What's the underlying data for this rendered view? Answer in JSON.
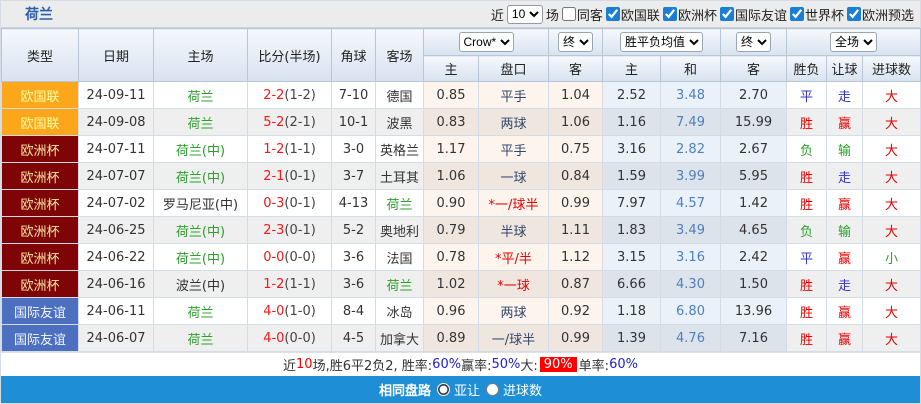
{
  "title": "荷兰",
  "controls": {
    "recent_label": "近",
    "matches_count": "10",
    "matches_label": "场",
    "checkboxes": [
      {
        "label": "同客",
        "checked": false
      },
      {
        "label": "欧国联",
        "checked": true
      },
      {
        "label": "欧洲杯",
        "checked": true
      },
      {
        "label": "国际友谊",
        "checked": true
      },
      {
        "label": "世界杯",
        "checked": true
      },
      {
        "label": "欧洲预选",
        "checked": true
      }
    ]
  },
  "header": {
    "columns": [
      "类型",
      "日期",
      "主场",
      "比分(半场)",
      "角球",
      "客场"
    ],
    "selects": {
      "odds_source": "Crow*",
      "odds_time1": "终",
      "avg_source": "胜平负均值",
      "odds_time2": "终",
      "scope": "全场"
    },
    "sub_columns": [
      "主",
      "盘口",
      "客",
      "主",
      "和",
      "客",
      "胜负",
      "让球",
      "进球数"
    ]
  },
  "rows": [
    {
      "type": "欧国联",
      "type_class": "t-nations",
      "date": "24-09-11",
      "home": "荷兰",
      "home_class": "green",
      "score": "2-2",
      "half": "(1-2)",
      "corners": "7-10",
      "away": "德国",
      "away_class": "",
      "crow_home": "0.85",
      "handicap": "平手",
      "handicap_class": "",
      "crow_away": "1.04",
      "avg_home": "2.52",
      "avg_draw": "3.48",
      "avg_away": "2.70",
      "result": "平",
      "result_class": "c-blue",
      "hres": "走",
      "hres_class": "c-blue",
      "goals": "大",
      "goals_class": "c-red"
    },
    {
      "type": "欧国联",
      "type_class": "t-nations",
      "date": "24-09-08",
      "home": "荷兰",
      "home_class": "green",
      "score": "5-2",
      "half": "(2-1)",
      "corners": "10-1",
      "away": "波黑",
      "away_class": "",
      "crow_home": "0.83",
      "handicap": "两球",
      "handicap_class": "",
      "crow_away": "1.06",
      "avg_home": "1.16",
      "avg_draw": "7.49",
      "avg_away": "15.99",
      "result": "胜",
      "result_class": "c-red",
      "hres": "赢",
      "hres_class": "c-red",
      "goals": "大",
      "goals_class": "c-red"
    },
    {
      "type": "欧洲杯",
      "type_class": "t-euro",
      "date": "24-07-11",
      "home": "荷兰(中)",
      "home_class": "green",
      "score": "1-2",
      "half": "(1-1)",
      "corners": "3-0",
      "away": "英格兰",
      "away_class": "",
      "crow_home": "1.17",
      "handicap": "平手",
      "handicap_class": "",
      "crow_away": "0.75",
      "avg_home": "3.16",
      "avg_draw": "2.82",
      "avg_away": "2.67",
      "result": "负",
      "result_class": "c-green",
      "hres": "输",
      "hres_class": "c-green",
      "goals": "大",
      "goals_class": "c-red"
    },
    {
      "type": "欧洲杯",
      "type_class": "t-euro",
      "date": "24-07-07",
      "home": "荷兰(中)",
      "home_class": "green",
      "score": "2-1",
      "half": "(0-1)",
      "corners": "3-7",
      "away": "土耳其",
      "away_class": "",
      "crow_home": "1.06",
      "handicap": "一球",
      "handicap_class": "",
      "crow_away": "0.84",
      "avg_home": "1.59",
      "avg_draw": "3.99",
      "avg_away": "5.95",
      "result": "胜",
      "result_class": "c-red",
      "hres": "走",
      "hres_class": "c-blue",
      "goals": "大",
      "goals_class": "c-red"
    },
    {
      "type": "欧洲杯",
      "type_class": "t-euro",
      "date": "24-07-02",
      "home": "罗马尼亚(中)",
      "home_class": "",
      "score": "0-3",
      "half": "(0-1)",
      "corners": "4-13",
      "away": "荷兰",
      "away_class": "green",
      "crow_home": "0.90",
      "handicap": "*一/球半",
      "handicap_class": "hcp-red",
      "crow_away": "0.99",
      "avg_home": "7.97",
      "avg_draw": "4.57",
      "avg_away": "1.42",
      "result": "胜",
      "result_class": "c-red",
      "hres": "赢",
      "hres_class": "c-red",
      "goals": "大",
      "goals_class": "c-red"
    },
    {
      "type": "欧洲杯",
      "type_class": "t-euro",
      "date": "24-06-25",
      "home": "荷兰(中)",
      "home_class": "green",
      "score": "2-3",
      "half": "(0-1)",
      "corners": "5-2",
      "away": "奥地利",
      "away_class": "",
      "crow_home": "0.79",
      "handicap": "半球",
      "handicap_class": "",
      "crow_away": "1.11",
      "avg_home": "1.83",
      "avg_draw": "3.49",
      "avg_away": "4.65",
      "result": "负",
      "result_class": "c-green",
      "hres": "输",
      "hres_class": "c-green",
      "goals": "大",
      "goals_class": "c-red"
    },
    {
      "type": "欧洲杯",
      "type_class": "t-euro",
      "date": "24-06-22",
      "home": "荷兰(中)",
      "home_class": "green",
      "score": "0-0",
      "half": "(0-0)",
      "corners": "3-6",
      "away": "法国",
      "away_class": "",
      "crow_home": "0.78",
      "handicap": "*平/半",
      "handicap_class": "hcp-red",
      "crow_away": "1.12",
      "avg_home": "3.15",
      "avg_draw": "3.16",
      "avg_away": "2.42",
      "result": "平",
      "result_class": "c-blue",
      "hres": "赢",
      "hres_class": "c-red",
      "goals": "小",
      "goals_class": "c-green"
    },
    {
      "type": "欧洲杯",
      "type_class": "t-euro",
      "date": "24-06-16",
      "home": "波兰(中)",
      "home_class": "",
      "score": "1-2",
      "half": "(1-1)",
      "corners": "3-6",
      "away": "荷兰",
      "away_class": "green",
      "crow_home": "1.02",
      "handicap": "*一球",
      "handicap_class": "hcp-red",
      "crow_away": "0.87",
      "avg_home": "6.66",
      "avg_draw": "4.30",
      "avg_away": "1.50",
      "result": "胜",
      "result_class": "c-red",
      "hres": "走",
      "hres_class": "c-blue",
      "goals": "大",
      "goals_class": "c-red"
    },
    {
      "type": "国际友谊",
      "type_class": "t-friendly",
      "date": "24-06-11",
      "home": "荷兰",
      "home_class": "green",
      "score": "4-0",
      "half": "(1-0)",
      "corners": "8-4",
      "away": "冰岛",
      "away_class": "",
      "crow_home": "0.96",
      "handicap": "两球",
      "handicap_class": "",
      "crow_away": "0.92",
      "avg_home": "1.18",
      "avg_draw": "6.80",
      "avg_away": "13.96",
      "result": "胜",
      "result_class": "c-red",
      "hres": "赢",
      "hres_class": "c-red",
      "goals": "大",
      "goals_class": "c-red"
    },
    {
      "type": "国际友谊",
      "type_class": "t-friendly",
      "date": "24-06-07",
      "home": "荷兰",
      "home_class": "green",
      "score": "4-0",
      "half": "(0-0)",
      "corners": "4-5",
      "away": "加拿大",
      "away_class": "",
      "crow_home": "0.89",
      "handicap": "一/球半",
      "handicap_class": "",
      "crow_away": "0.99",
      "avg_home": "1.39",
      "avg_draw": "4.76",
      "avg_away": "7.16",
      "result": "胜",
      "result_class": "c-red",
      "hres": "赢",
      "hres_class": "c-red",
      "goals": "大",
      "goals_class": "c-red"
    }
  ],
  "summary_segments": [
    {
      "text": "近",
      "class": ""
    },
    {
      "text": "10",
      "class": "s-red"
    },
    {
      "text": "场,胜6平2负2, 胜率:",
      "class": ""
    },
    {
      "text": "60%",
      "class": "s-blue"
    },
    {
      "text": " 赢率:",
      "class": ""
    },
    {
      "text": "50%",
      "class": "s-blue"
    },
    {
      "text": " 大: ",
      "class": ""
    },
    {
      "text": "90%",
      "class": "s-badge"
    },
    {
      "text": " 单率:",
      "class": ""
    },
    {
      "text": "60%",
      "class": "s-blue"
    }
  ],
  "footer": {
    "label": "相同盘路",
    "options": [
      {
        "label": "亚让",
        "checked": true
      },
      {
        "label": "进球数",
        "checked": false
      }
    ]
  },
  "colors": {
    "accent_blue": "#1E8FD6",
    "title_blue": "#2B5DAD",
    "badge_nations": "#FCA61C",
    "badge_euro": "#7E0406",
    "badge_friendly": "#4D6FC0",
    "win_red": "#E60000",
    "draw_blue": "#3333CC",
    "lose_green": "#2CA02C",
    "highlight_badge_bg": "#FF0000"
  }
}
